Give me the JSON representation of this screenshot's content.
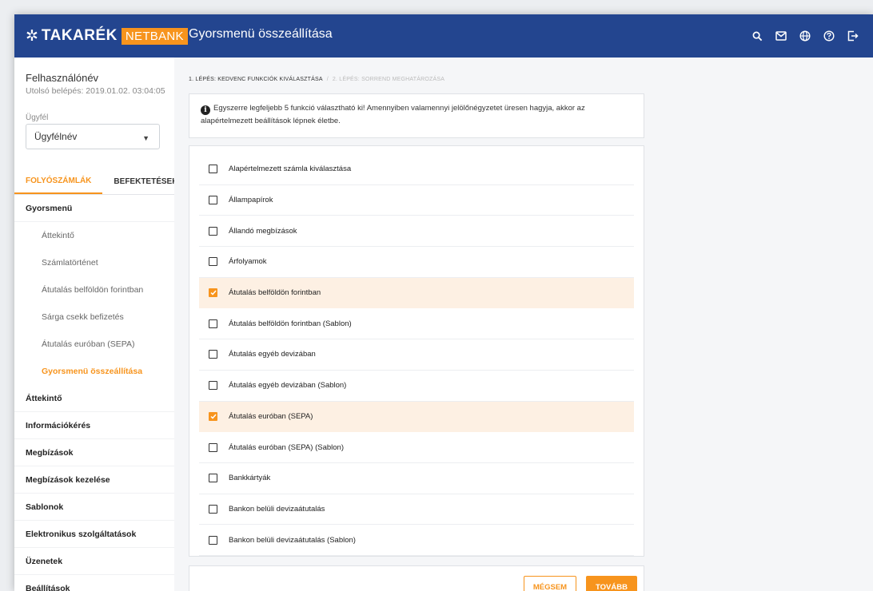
{
  "header": {
    "logo_text": "TAKARÉK",
    "logo_badge": "NETBANK",
    "page_title": "Gyorsmenü összeállítása",
    "icons": [
      "search-icon",
      "mail-icon",
      "globe-icon",
      "help-icon",
      "logout-icon"
    ]
  },
  "sidebar": {
    "user_name": "Felhasználónév",
    "last_login": "Utolsó belépés: 2019.01.02. 03:04:05",
    "client_label": "Ügyfél",
    "client_value": "Ügyfélnév",
    "tabs": [
      "FOLYÓSZÁMLÁK",
      "BEFEKTETÉSEK"
    ],
    "nav": [
      {
        "label": "Gyorsmenü"
      },
      {
        "label": "Áttekintő"
      },
      {
        "label": "Számlatörténet"
      },
      {
        "label": "Átutalás belföldön forintban"
      },
      {
        "label": "Sárga csekk befizetés"
      },
      {
        "label": "Átutalás euróban (SEPA)"
      },
      {
        "label": "Gyorsmenü összeállítása"
      },
      {
        "label": "Áttekintő"
      },
      {
        "label": "Információkérés"
      },
      {
        "label": "Megbízások"
      },
      {
        "label": "Megbízások kezelése"
      },
      {
        "label": "Sablonok"
      },
      {
        "label": "Elektronikus szolgáltatások"
      },
      {
        "label": "Üzenetek"
      },
      {
        "label": "Beállítások"
      }
    ]
  },
  "main": {
    "breadcrumb": {
      "step1": "1. LÉPÉS: KEDVENC FUNKCIÓK KIVÁLASZTÁSA",
      "separator": "/",
      "step2": "2. LÉPÉS: SORREND MEGHATÁROZÁSA"
    },
    "info_line1": "Egyszerre legfeljebb 5 funkció választható ki! Amennyiben valamennyi jelölőnégyzetet üresen hagyja, akkor az",
    "info_line2": "alapértelmezett beállítások lépnek életbe.",
    "items": [
      {
        "label": "Alapértelmezett számla kiválasztása",
        "checked": false
      },
      {
        "label": "Állampapírok",
        "checked": false
      },
      {
        "label": "Állandó megbízások",
        "checked": false
      },
      {
        "label": "Árfolyamok",
        "checked": false
      },
      {
        "label": "Átutalás belföldön forintban",
        "checked": true
      },
      {
        "label": "Átutalás belföldön forintban (Sablon)",
        "checked": false
      },
      {
        "label": "Átutalás egyéb devizában",
        "checked": false
      },
      {
        "label": "Átutalás egyéb devizában (Sablon)",
        "checked": false
      },
      {
        "label": "Átutalás euróban (SEPA)",
        "checked": true
      },
      {
        "label": "Átutalás euróban (SEPA) (Sablon)",
        "checked": false
      },
      {
        "label": "Bankkártyák",
        "checked": false
      },
      {
        "label": "Bankon belüli devizaátutalás",
        "checked": false
      },
      {
        "label": "Bankon belüli devizaátutalás (Sablon)",
        "checked": false
      }
    ],
    "cancel_label": "MÉGSEM",
    "next_label": "TOVÁBB"
  },
  "colors": {
    "brand_blue": "#23458f",
    "accent_orange": "#f7941d",
    "checked_row": "#fdf0e3"
  }
}
